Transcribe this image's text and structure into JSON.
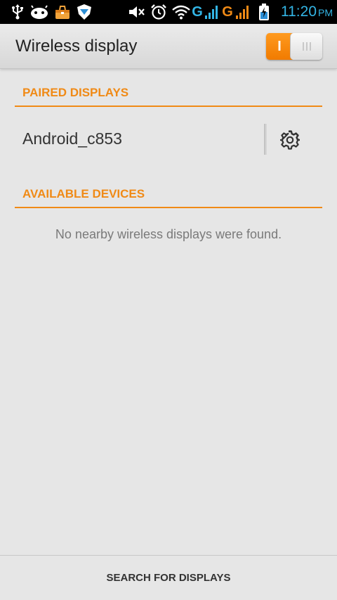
{
  "status_bar": {
    "icons": [
      "usb-icon",
      "android-icon",
      "toolbox-icon",
      "shield-icon",
      "mute-icon",
      "alarm-icon",
      "wifi-icon",
      "signal-1-icon",
      "signal-2-icon",
      "battery-charging-icon"
    ],
    "network_label_1": "G",
    "network_label_2": "G",
    "time": "11:20",
    "ampm": "PM",
    "accent": "#33b5e5",
    "sim2_color": "#f08a16"
  },
  "header": {
    "title": "Wireless display",
    "toggle_on_label": "I",
    "toggle_state": "on"
  },
  "paired": {
    "header": "PAIRED DISPLAYS",
    "devices": [
      {
        "name": "Android_c853",
        "settings_icon": "gear-icon"
      }
    ]
  },
  "available": {
    "header": "AVAILABLE DEVICES",
    "empty_message": "No nearby wireless displays were found."
  },
  "footer": {
    "button_label": "SEARCH FOR DISPLAYS"
  },
  "colors": {
    "accent": "#f08a16",
    "background": "#e6e6e6"
  }
}
